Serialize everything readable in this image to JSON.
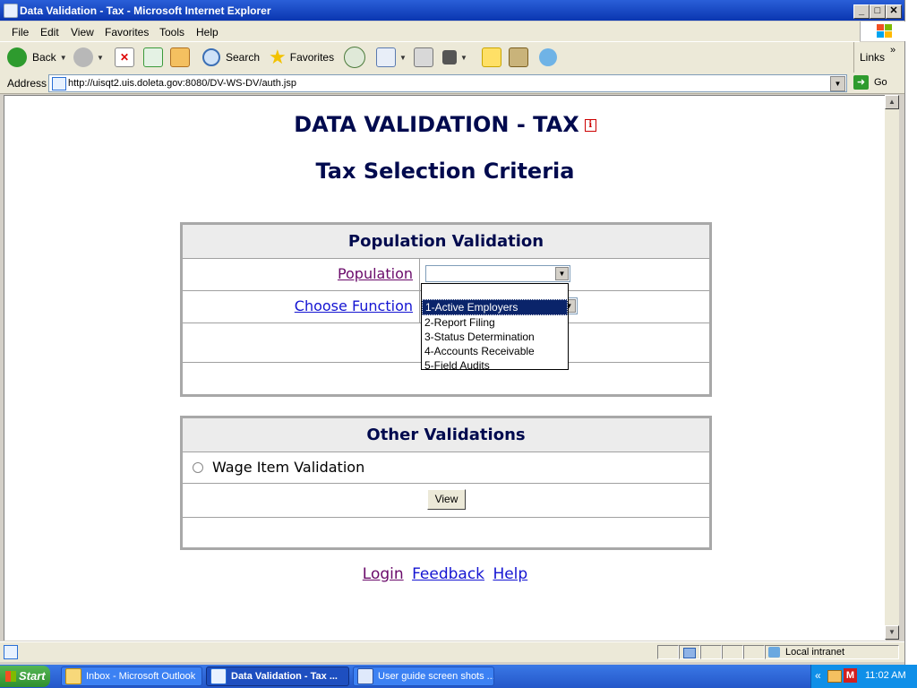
{
  "window": {
    "title": "Data Validation - Tax - Microsoft Internet Explorer",
    "buttons": {
      "minimize": "_",
      "maximize": "□",
      "close": "✕"
    }
  },
  "menu": [
    "File",
    "Edit",
    "View",
    "Favorites",
    "Tools",
    "Help"
  ],
  "toolbar": {
    "back": "Back",
    "search": "Search",
    "favorites": "Favorites",
    "links": "Links"
  },
  "address": {
    "label": "Address",
    "url": "http://uisqt2.uis.doleta.gov:8080/DV-WS-DV/auth.jsp",
    "go": "Go"
  },
  "page": {
    "title": "DATA VALIDATION - TAX",
    "info_icon": "i",
    "subtitle": "Tax Selection Criteria",
    "population_panel": {
      "header": "Population Validation",
      "population_label": "Population",
      "population_value": "",
      "function_label": "Choose Function",
      "dropdown_options": [
        "1-Active Employers",
        "2-Report Filing",
        "3-Status Determination",
        "4-Accounts Receivable",
        "5-Field Audits"
      ],
      "highlighted_option_index": 0
    },
    "other_panel": {
      "header": "Other Validations",
      "wage_item_label": "Wage Item Validation",
      "view_button": "View"
    },
    "footer_links": {
      "login": "Login",
      "feedback": "Feedback",
      "help": "Help"
    }
  },
  "status": {
    "zone": "Local intranet"
  },
  "taskbar": {
    "start": "Start",
    "tasks": [
      {
        "label": "Inbox - Microsoft Outlook",
        "active": false
      },
      {
        "label": "Data Validation - Tax ...",
        "active": true
      },
      {
        "label": "User guide screen shots ...",
        "active": false
      }
    ],
    "tray_chevron": "«",
    "clock": "11:02 AM"
  }
}
